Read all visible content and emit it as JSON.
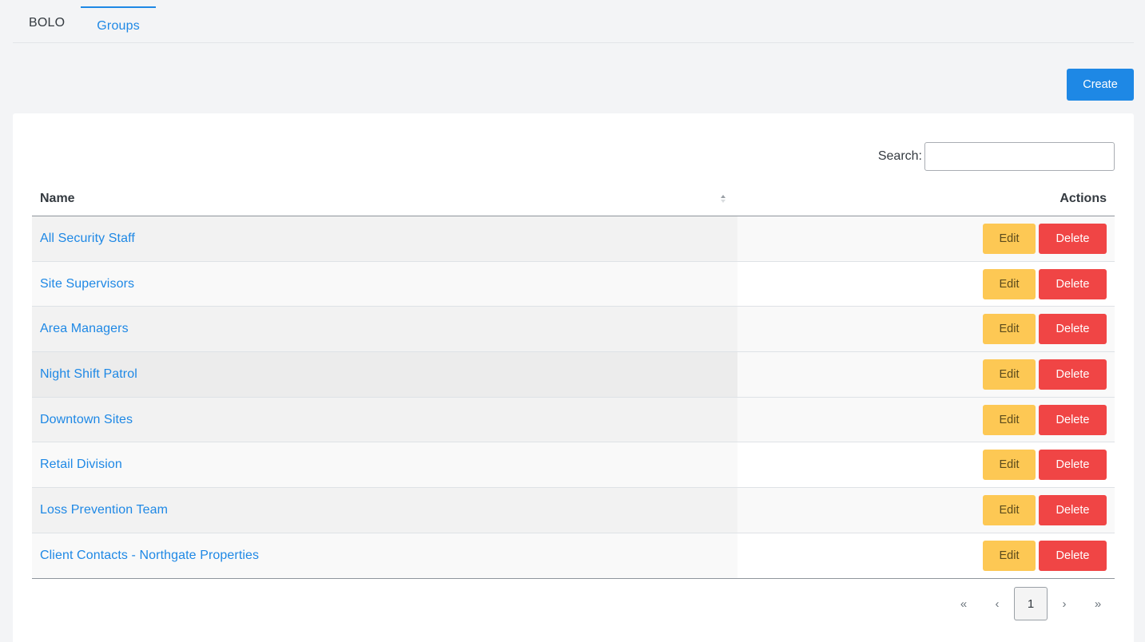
{
  "tabs": [
    {
      "label": "BOLO",
      "active": false
    },
    {
      "label": "Groups",
      "active": true
    }
  ],
  "toolbar": {
    "create_label": "Create"
  },
  "search": {
    "label": "Search:",
    "value": "",
    "placeholder": ""
  },
  "table": {
    "columns": {
      "name": "Name",
      "actions": "Actions"
    },
    "rows": [
      {
        "name": "All Security Staff"
      },
      {
        "name": "Site Supervisors"
      },
      {
        "name": "Area Managers"
      },
      {
        "name": "Night Shift Patrol"
      },
      {
        "name": "Downtown Sites"
      },
      {
        "name": "Retail Division"
      },
      {
        "name": "Loss Prevention Team"
      },
      {
        "name": "Client Contacts - Northgate Properties"
      }
    ],
    "edit_label": "Edit",
    "delete_label": "Delete"
  },
  "pagination": {
    "first": "«",
    "prev": "‹",
    "current": "1",
    "next": "›",
    "last": "»"
  },
  "colors": {
    "accent": "#1e88e5",
    "edit": "#fdc854",
    "delete": "#f04545"
  }
}
